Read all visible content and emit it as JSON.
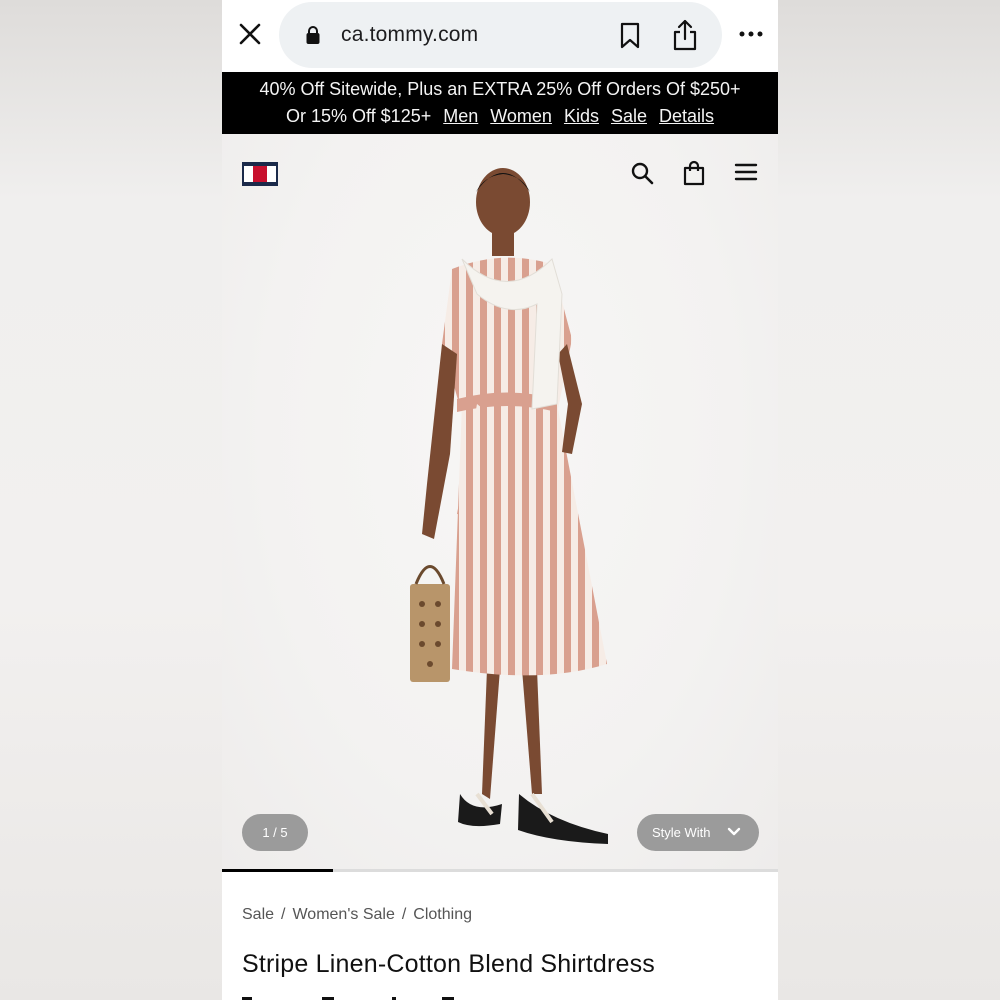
{
  "browser": {
    "url": "ca.tommy.com"
  },
  "promo": {
    "line1": "40% Off Sitewide, Plus an EXTRA 25% Off Orders Of $250+",
    "line2_prefix": "Or 15% Off $125+",
    "links": [
      "Men",
      "Women",
      "Kids",
      "Sale",
      "Details"
    ]
  },
  "gallery": {
    "counter": "1 / 5",
    "current_image": 1,
    "total_images": 5,
    "style_with_label": "Style With"
  },
  "breadcrumb": [
    "Sale",
    "Women's Sale",
    "Clothing"
  ],
  "product": {
    "title": "Stripe Linen-Cotton Blend Shirtdress"
  },
  "colors": {
    "promo_bg": "#000000",
    "logo_navy": "#1b2a4a",
    "logo_red": "#c8102e",
    "pill_bg": "#9b9b9b",
    "dress_stripe": "#d9a08f"
  },
  "icons": [
    "close-icon",
    "lock-icon",
    "bookmark-icon",
    "share-icon",
    "more-icon",
    "search-icon",
    "bag-icon",
    "menu-icon",
    "chevron-down-icon"
  ]
}
